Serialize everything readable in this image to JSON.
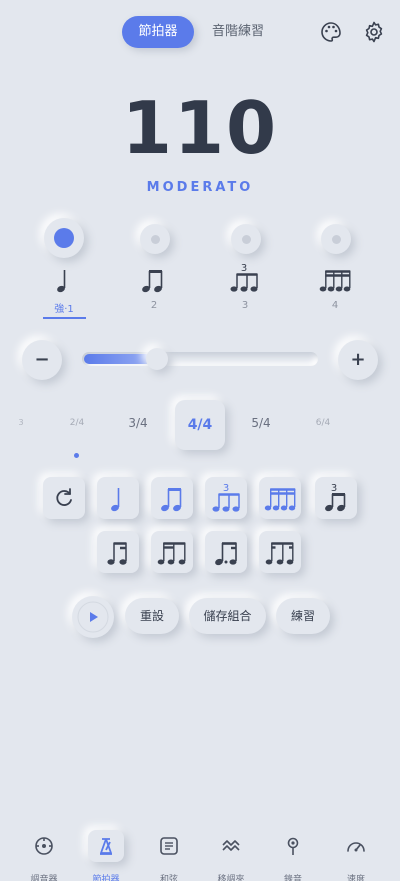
{
  "tabs": [
    {
      "label": "節拍器",
      "active": true
    },
    {
      "label": "音階練習",
      "active": false
    }
  ],
  "tempo": {
    "bpm": "110",
    "marking": "MODERATO"
  },
  "beats": [
    {
      "label": "強·1",
      "active": true
    },
    {
      "label": "2"
    },
    {
      "label": "3"
    },
    {
      "label": "4"
    }
  ],
  "beat_icons": [
    "quarter-note-icon",
    "eighth-notes-icon",
    "triplet-icon",
    "sixteenth-notes-icon"
  ],
  "triplet_mark": "3",
  "controls": {
    "minus": "−",
    "plus": "+",
    "tempo_slider_fraction": 0.3
  },
  "time_signatures": [
    "3",
    "2/4",
    "3/4",
    "4/4",
    "5/4",
    "6/4"
  ],
  "selected_time_signature": "4/4",
  "actions": {
    "reset": "重設",
    "save": "儲存組合",
    "practice": "練習"
  },
  "nav": [
    {
      "label": "調音器",
      "icon": "tuner-icon"
    },
    {
      "label": "節拍器",
      "icon": "metronome-icon",
      "active": true
    },
    {
      "label": "和弦",
      "icon": "chord-icon"
    },
    {
      "label": "移調夾",
      "icon": "capo-icon"
    },
    {
      "label": "錄音",
      "icon": "mic-icon"
    },
    {
      "label": "速度",
      "icon": "speed-icon"
    }
  ],
  "colors": {
    "accent": "#5b7bea",
    "background": "#e3e7ee",
    "text": "#323a4a"
  }
}
